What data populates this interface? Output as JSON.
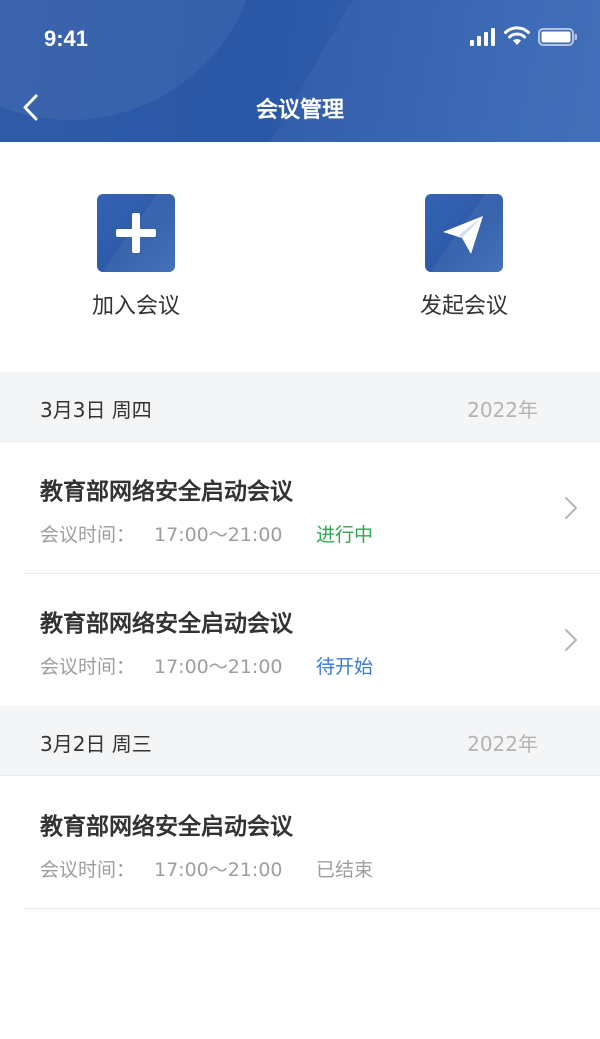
{
  "status_bar": {
    "time": "9:41"
  },
  "nav": {
    "title": "会议管理"
  },
  "actions": [
    {
      "label": "加入会议",
      "icon": "plus-icon"
    },
    {
      "label": "发起会议",
      "icon": "paper-plane-icon"
    }
  ],
  "groups": [
    {
      "date": "3月3日 周四",
      "year": "2022年",
      "meetings": [
        {
          "title": "教育部网络安全启动会议",
          "time_label": "会议时间：",
          "time": "17:00～21:00",
          "status": "进行中",
          "status_color": "#2fa84f"
        },
        {
          "title": "教育部网络安全启动会议",
          "time_label": "会议时间：",
          "time": "17:00～21:00",
          "status": "待开始",
          "status_color": "#3a7bd5"
        }
      ]
    },
    {
      "date": "3月2日 周三",
      "year": "2022年",
      "meetings": [
        {
          "title": "教育部网络安全启动会议",
          "time_label": "会议时间：",
          "time": "17:00～21:00",
          "status": "已结束",
          "status_color": "#9e9e9e"
        }
      ]
    }
  ],
  "colors": {
    "header": "#2f5ba8",
    "accent": "#2d5aa8",
    "in_progress": "#2fa84f",
    "pending": "#3a7bd5",
    "ended": "#9e9e9e"
  }
}
